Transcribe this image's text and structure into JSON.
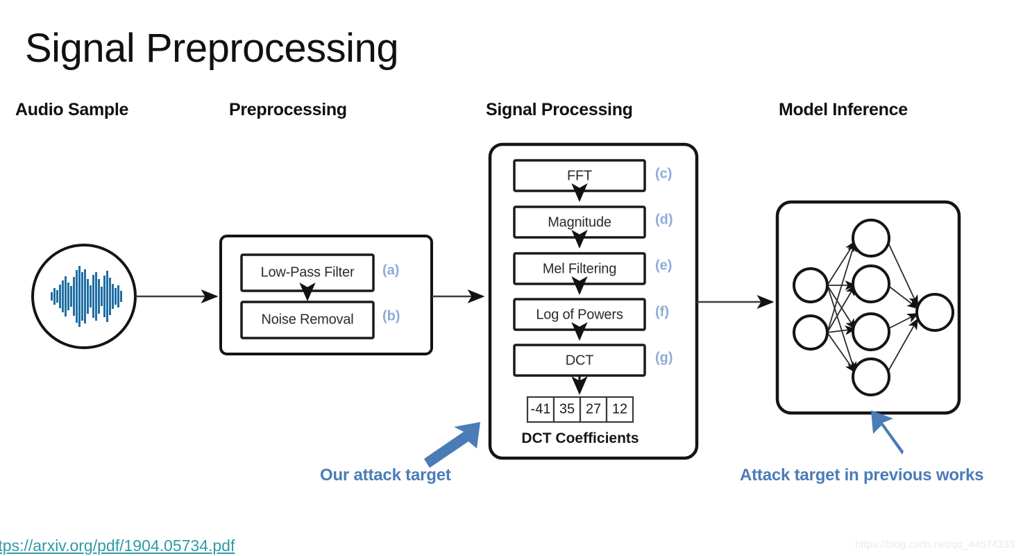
{
  "slide": {
    "title": "Signal Preprocessing"
  },
  "columns": [
    {
      "id": "audio-sample",
      "label": "Audio Sample"
    },
    {
      "id": "preprocessing",
      "label": "Preprocessing"
    },
    {
      "id": "signal-processing",
      "label": "Signal Processing"
    },
    {
      "id": "model-inference",
      "label": "Model Inference"
    }
  ],
  "audio_sample": {
    "icon": "audio-waveform-icon"
  },
  "preprocessing_stage": {
    "steps": [
      {
        "tag": "(a)",
        "label": "Low-Pass Filter"
      },
      {
        "tag": "(b)",
        "label": "Noise Removal"
      }
    ]
  },
  "signal_processing_stage": {
    "steps": [
      {
        "tag": "(c)",
        "label": "FFT"
      },
      {
        "tag": "(d)",
        "label": "Magnitude"
      },
      {
        "tag": "(e)",
        "label": "Mel Filtering"
      },
      {
        "tag": "(f)",
        "label": "Log of Powers"
      },
      {
        "tag": "(g)",
        "label": "DCT"
      }
    ],
    "coefficients": [
      "-41",
      "35",
      "27",
      "12"
    ],
    "coefficients_caption": "DCT Coefficients"
  },
  "model_inference_stage": {
    "network": {
      "input_nodes": 2,
      "hidden_nodes": 4,
      "output_nodes": 1
    }
  },
  "callouts": [
    {
      "id": "our-attack-target",
      "label": "Our attack target"
    },
    {
      "id": "previous-attack-target",
      "label": "Attack target in previous works"
    }
  ],
  "footer": {
    "source_link": "ttps://arxiv.org/pdf/1904.05734.pdf",
    "watermark": "https://blog.csdn.net/qq_44574333"
  },
  "colors": {
    "accent_blue": "#4a7cb8",
    "tag_blue": "#8fa9d8",
    "waveform_blue": "#1f6fa4",
    "link_teal": "#2f9aa6",
    "outline_black": "#141414"
  }
}
